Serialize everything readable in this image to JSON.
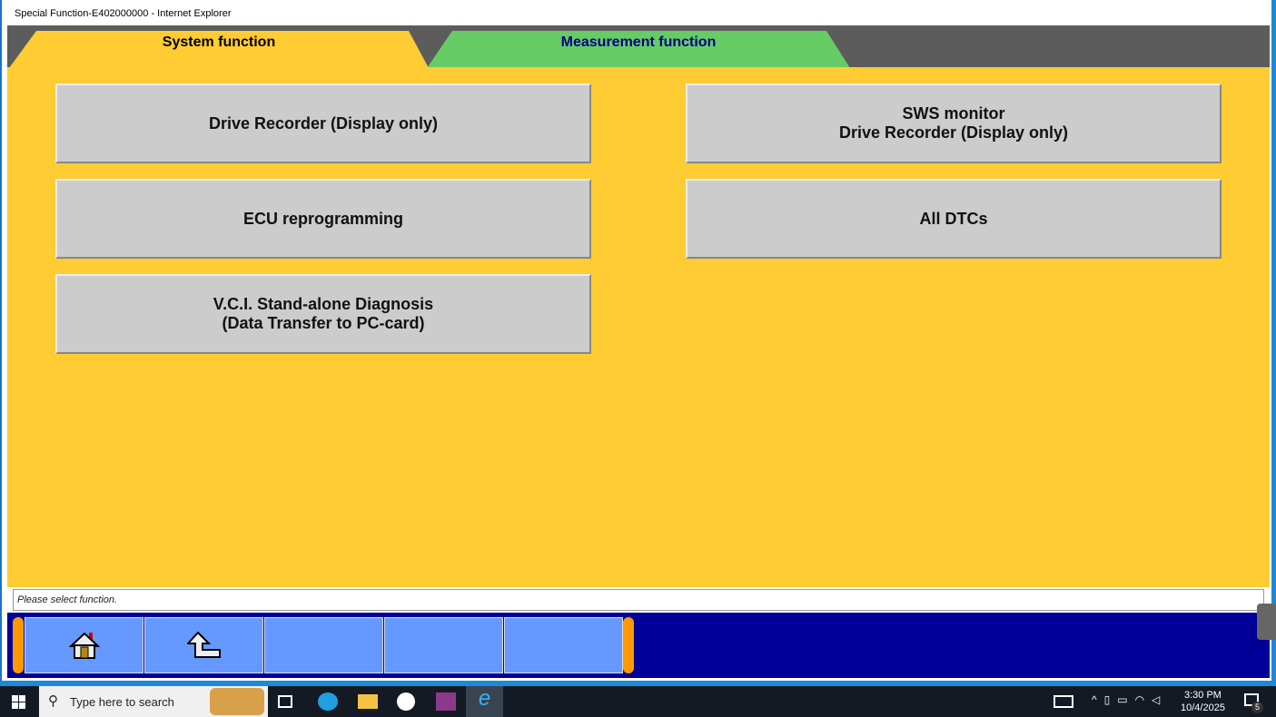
{
  "window": {
    "title": "Special Function-E402000000 - Internet Explorer"
  },
  "tabs": [
    {
      "label": "System function"
    },
    {
      "label": "Measurement function"
    }
  ],
  "functions": [
    {
      "label": "Drive Recorder (Display only)"
    },
    {
      "label": "SWS monitor\nDrive Recorder (Display only)"
    },
    {
      "label": "ECU reprogramming"
    },
    {
      "label": "All DTCs"
    },
    {
      "label": "V.C.I. Stand-alone Diagnosis\n(Data Transfer to PC-card)"
    }
  ],
  "status": {
    "message": "Please select function."
  },
  "colors": {
    "content": "#ffcc33",
    "bar": "#000099",
    "nav": "#6699ff",
    "tab2": "#66cc66"
  },
  "taskbar": {
    "search_placeholder": "Type here to search",
    "time": "3:30 PM",
    "date": "10/4/2025",
    "notifications": "5"
  }
}
